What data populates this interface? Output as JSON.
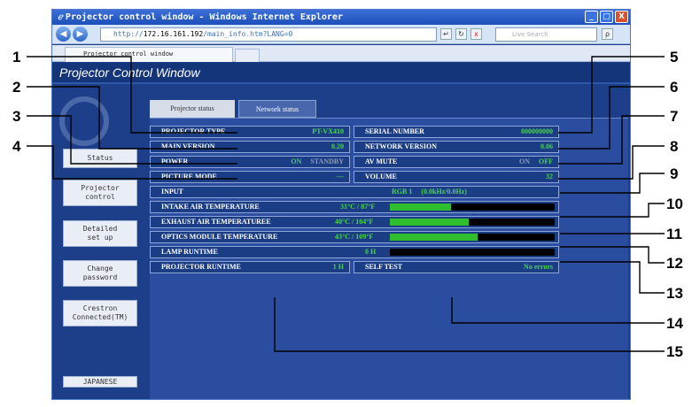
{
  "window": {
    "title": "Projector control window - Windows Internet Explorer",
    "url_prefix": "http://",
    "url_host": "172.16.161.192",
    "url_path": "/main_info.htm?LANG=0",
    "search_placeholder": "Live Search",
    "tab_label": "Projector control window",
    "minimize_glyph": "_",
    "maximize_glyph": "□",
    "close_glyph": "X",
    "back_glyph": "◀",
    "forward_glyph": "▶",
    "go_glyph": "↵",
    "refresh_glyph": "↻",
    "stop_glyph": "x",
    "search_glyph": "ρ"
  },
  "app": {
    "title": "Projector Control Window",
    "tabs": [
      "Projector status",
      "Network status"
    ],
    "sidebar": [
      "Status",
      "Projector\ncontrol",
      "Detailed\nset up",
      "Change\npassword",
      "Crestron\nConnected(TM)",
      "JAPANESE"
    ]
  },
  "status": {
    "projector_type": {
      "label": "PROJECTOR TYPE",
      "value": "PT-VX410"
    },
    "serial_number": {
      "label": "SERIAL NUMBER",
      "value": "000000000"
    },
    "main_version": {
      "label": "MAIN VERSION",
      "value": "0.20"
    },
    "network_version": {
      "label": "NETWORK VERSION",
      "value": "0.06"
    },
    "power": {
      "label": "POWER",
      "on": "ON",
      "standby": "STANDBY"
    },
    "av_mute": {
      "label": "AV MUTE",
      "on": "ON",
      "off": "OFF"
    },
    "picture_mode": {
      "label": "PICTURE MODE",
      "value": "---"
    },
    "volume": {
      "label": "VOLUME",
      "value": "32"
    },
    "input": {
      "label": "INPUT",
      "value": "RGB 1",
      "frequency": "(0.0kHz/0.0Hz)"
    },
    "intake_temp": {
      "label": "INTAKE AIR TEMPERATURE",
      "value": "31°C / 87°F",
      "level": 0.37
    },
    "exhaust_temp": {
      "label": "EXHAUST AIR TEMPERATUREE",
      "value": "40°C / 104°F",
      "level": 0.48
    },
    "optics_temp": {
      "label": "OPTICS MODULE TEMPERATURE",
      "value": "43°C / 109°F",
      "level": 0.53
    },
    "lamp_runtime": {
      "label": "LAMP RUNTIME",
      "value": "0 H",
      "level": 0
    },
    "projector_runtime": {
      "label": "PROJECTOR RUNTIME",
      "value": "1 H"
    },
    "self_test": {
      "label": "SELF TEST",
      "value": "No errors"
    }
  },
  "callouts": [
    "1",
    "2",
    "3",
    "4",
    "5",
    "6",
    "7",
    "8",
    "9",
    "10",
    "11",
    "12",
    "13",
    "14",
    "15"
  ],
  "colors": {
    "window_frame": "#1d3f8a",
    "field_bg": "#1b3d86",
    "value_green": "#49d64a",
    "bar_fill": "#2fbf2e"
  }
}
